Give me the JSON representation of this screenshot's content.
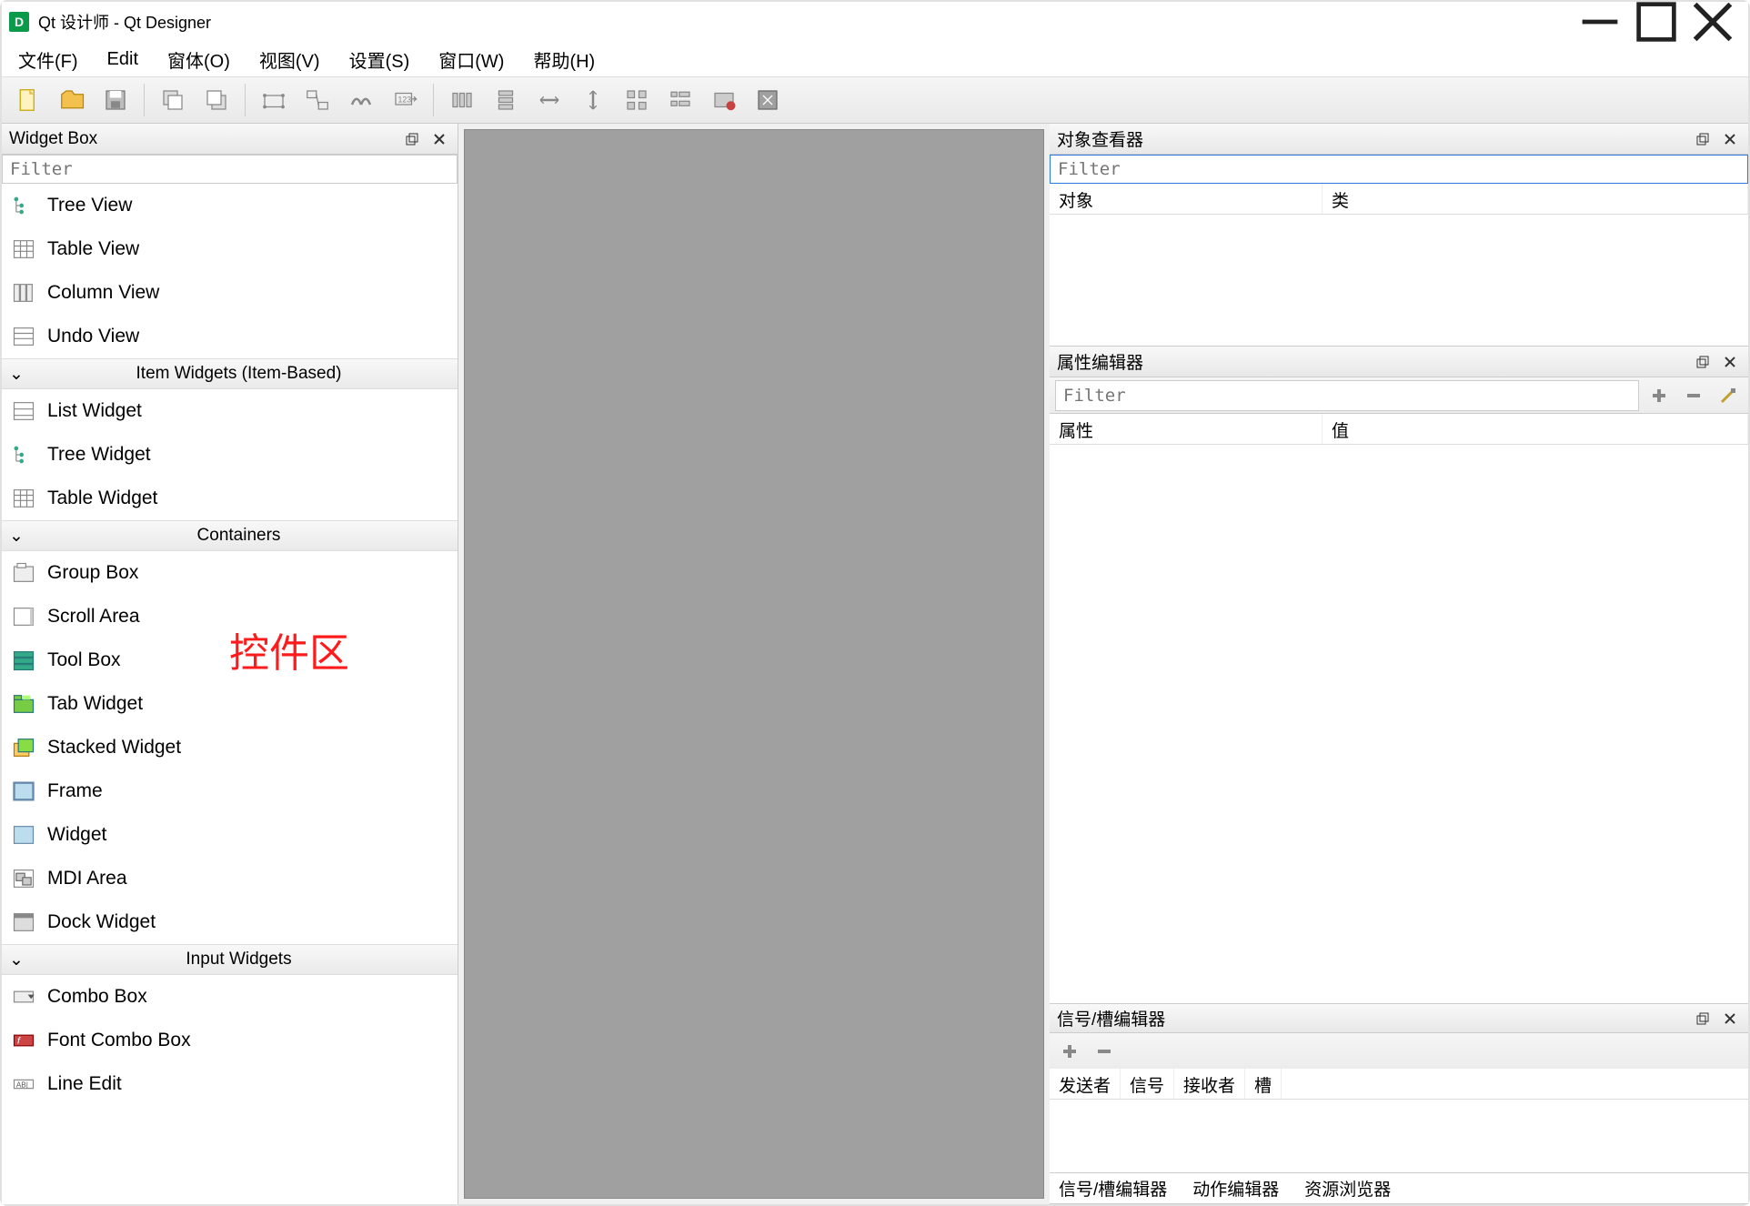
{
  "window": {
    "title": "Qt 设计师 - Qt Designer",
    "app_icon_letter": "D"
  },
  "menubar": [
    {
      "label": "文件(F)",
      "accel": "F"
    },
    {
      "label": "Edit",
      "accel": ""
    },
    {
      "label": "窗体(O)",
      "accel": "O"
    },
    {
      "label": "视图(V)",
      "accel": "V"
    },
    {
      "label": "设置(S)",
      "accel": "S"
    },
    {
      "label": "窗口(W)",
      "accel": "W"
    },
    {
      "label": "帮助(H)",
      "accel": "H"
    }
  ],
  "toolbar": {
    "groups": [
      [
        "new-file",
        "open-file",
        "save-file"
      ],
      [
        "copy",
        "paste"
      ],
      [
        "edit-widgets",
        "signal-slot",
        "buddies",
        "tab-order"
      ],
      [
        "layout-hbox",
        "layout-vbox",
        "layout-h-splitter",
        "layout-v-splitter",
        "layout-grid",
        "layout-form",
        "break-layout",
        "adjust-size"
      ]
    ]
  },
  "widget_box": {
    "title": "Widget Box",
    "filter_placeholder": "Filter",
    "sections": [
      {
        "name": "_preitems",
        "items": [
          {
            "icon": "tree-view-icon",
            "label": "Tree View"
          },
          {
            "icon": "table-view-icon",
            "label": "Table View"
          },
          {
            "icon": "column-view-icon",
            "label": "Column View"
          },
          {
            "icon": "undo-view-icon",
            "label": "Undo View"
          }
        ]
      },
      {
        "name": "Item Widgets (Item-Based)",
        "items": [
          {
            "icon": "list-widget-icon",
            "label": "List Widget"
          },
          {
            "icon": "tree-widget-icon",
            "label": "Tree Widget"
          },
          {
            "icon": "table-widget-icon",
            "label": "Table Widget"
          }
        ]
      },
      {
        "name": "Containers",
        "items": [
          {
            "icon": "group-box-icon",
            "label": "Group Box"
          },
          {
            "icon": "scroll-area-icon",
            "label": "Scroll Area"
          },
          {
            "icon": "tool-box-icon",
            "label": "Tool Box"
          },
          {
            "icon": "tab-widget-icon",
            "label": "Tab Widget"
          },
          {
            "icon": "stacked-widget-icon",
            "label": "Stacked Widget"
          },
          {
            "icon": "frame-icon",
            "label": "Frame"
          },
          {
            "icon": "widget-icon",
            "label": "Widget"
          },
          {
            "icon": "mdi-area-icon",
            "label": "MDI Area"
          },
          {
            "icon": "dock-widget-icon",
            "label": "Dock Widget"
          }
        ]
      },
      {
        "name": "Input Widgets",
        "items": [
          {
            "icon": "combo-box-icon",
            "label": "Combo Box"
          },
          {
            "icon": "font-combo-icon",
            "label": "Font Combo Box"
          },
          {
            "icon": "line-edit-icon",
            "label": "Line Edit"
          }
        ]
      }
    ]
  },
  "annotation": {
    "red_text": "控件区"
  },
  "object_inspector": {
    "title": "对象查看器",
    "filter_placeholder": "Filter",
    "columns": [
      "对象",
      "类"
    ]
  },
  "property_editor": {
    "title": "属性编辑器",
    "filter_placeholder": "Filter",
    "columns": [
      "属性",
      "值"
    ]
  },
  "signal_slot_editor": {
    "title": "信号/槽编辑器",
    "columns": [
      "发送者",
      "信号",
      "接收者",
      "槽"
    ]
  },
  "bottom_tabs": [
    "信号/槽编辑器",
    "动作编辑器",
    "资源浏览器"
  ]
}
